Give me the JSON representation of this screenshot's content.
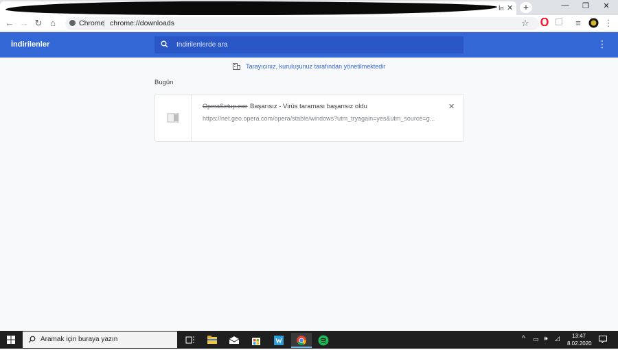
{
  "browser": {
    "tab_title": "İn",
    "omnibox_site": "Chrome",
    "omnibox_url": "chrome://downloads"
  },
  "downloads": {
    "title": "İndirilenler",
    "search_placeholder": "İndirilenlerde ara",
    "managed_notice": "Tarayıcınız, kuruluşunuz tarafından yönetilmektedir",
    "section_label": "Bugün",
    "items": [
      {
        "file_name": "OperaSetup.exe",
        "status": "Başarısız - Virüs taraması başarısız oldu",
        "url": "https://net.geo.opera.com/opera/stable/windows?utm_tryagain=yes&utm_source=g..."
      }
    ]
  },
  "taskbar": {
    "search_placeholder": "Aramak için buraya yazın",
    "time": "13:47",
    "date": "8.02.2020"
  },
  "colors": {
    "header_blue": "#3367d6",
    "search_blue": "#2a56c6",
    "taskbar": "#1f1f1f"
  },
  "icons": [
    "back-arrow-icon",
    "forward-arrow-icon",
    "reload-icon",
    "home-icon",
    "star-icon",
    "opera-icon",
    "extension-icon",
    "media-icon",
    "profile-icon",
    "menu-icon",
    "search-icon",
    "building-icon",
    "file-icon",
    "close-icon",
    "windows-start-icon",
    "task-view-icon",
    "file-explorer-icon",
    "mail-icon",
    "store-icon",
    "app-icon",
    "chrome-icon",
    "spotify-icon"
  ]
}
